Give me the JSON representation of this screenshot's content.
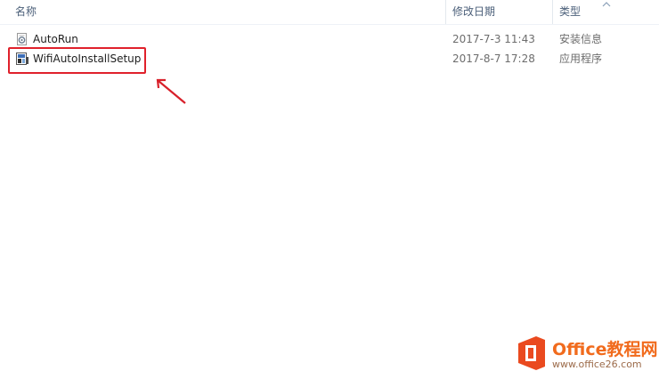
{
  "header": {
    "col_name": "名称",
    "col_date": "修改日期",
    "col_type": "类型"
  },
  "files": [
    {
      "name": "AutoRun",
      "date": "2017-7-3 11:43",
      "type": "安装信息",
      "icon": "settings-file-icon"
    },
    {
      "name": "WifiAutoInstallSetup",
      "date": "2017-8-7 17:28",
      "type": "应用程序",
      "icon": "installer-icon"
    }
  ],
  "watermark": {
    "brand": "Office教程网",
    "url": "www.office26.com"
  },
  "colors": {
    "highlight": "#e0212b",
    "watermark": "#f16b1d"
  }
}
